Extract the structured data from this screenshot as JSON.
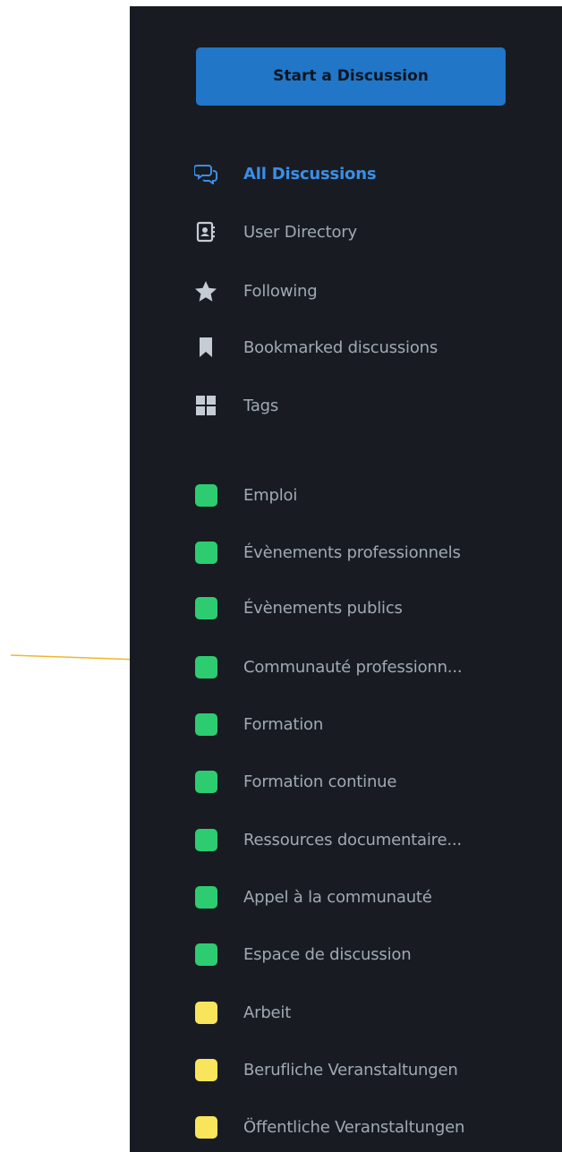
{
  "sidebar": {
    "start_button": "Start a Discussion",
    "nav": [
      {
        "label": "All Discussions",
        "icon": "comments-icon",
        "active": true
      },
      {
        "label": "User Directory",
        "icon": "address-book-icon",
        "active": false
      },
      {
        "label": "Following",
        "icon": "star-icon",
        "active": false
      },
      {
        "label": "Bookmarked discussions",
        "icon": "bookmark-icon",
        "active": false
      },
      {
        "label": "Tags",
        "icon": "grid-icon",
        "active": false
      }
    ],
    "tags": [
      {
        "label": "Emploi",
        "color": "#2ecc71"
      },
      {
        "label": "Évènements professionnels",
        "color": "#2ecc71"
      },
      {
        "label": "Évènements publics",
        "color": "#2ecc71"
      },
      {
        "label": "Communauté professionn...",
        "color": "#2ecc71"
      },
      {
        "label": "Formation",
        "color": "#2ecc71"
      },
      {
        "label": "Formation continue",
        "color": "#2ecc71"
      },
      {
        "label": "Ressources documentaire...",
        "color": "#2ecc71"
      },
      {
        "label": "Appel à la communauté",
        "color": "#2ecc71"
      },
      {
        "label": "Espace de discussion",
        "color": "#2ecc71"
      },
      {
        "label": "Arbeit",
        "color": "#f9e55c"
      },
      {
        "label": "Berufliche Veranstaltungen",
        "color": "#f9e55c"
      },
      {
        "label": "Öffentliche Veranstaltungen",
        "color": "#f9e55c"
      }
    ]
  },
  "colors": {
    "panel_bg": "#181c22",
    "accent": "#2176c7",
    "active_text": "#3b8ee6",
    "muted_text": "#a0a9b4",
    "annotation": "#f0b62c"
  }
}
